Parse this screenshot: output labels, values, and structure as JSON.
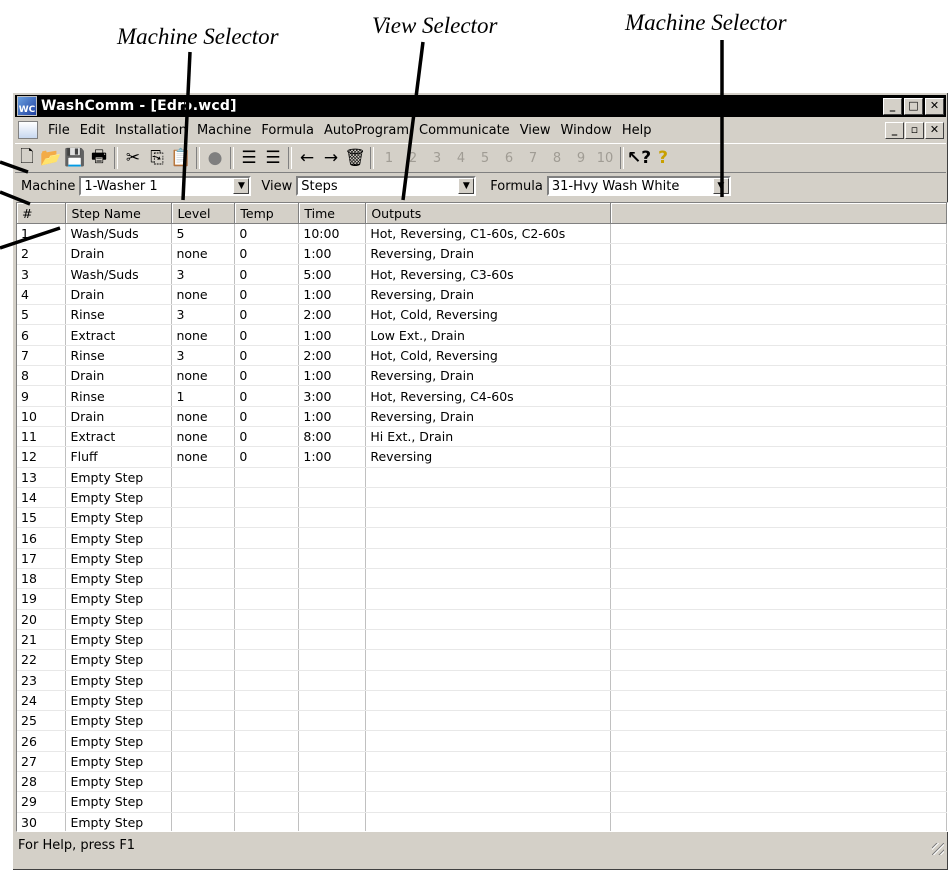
{
  "callouts": {
    "machine_selector_left": "Machine Selector",
    "view_selector": "View Selector",
    "machine_selector_right": "Machine Selector"
  },
  "window": {
    "title": "WashComm - [Edrɔ.wcd]",
    "icon_text": "WC"
  },
  "menu": {
    "file": "File",
    "edit": "Edit",
    "installation": "Installation",
    "machine": "Machine",
    "formula": "Formula",
    "autoprogram": "AutoProgram",
    "communicate": "Communicate",
    "view": "View",
    "window": "Window",
    "help": "Help"
  },
  "toolbar": {
    "icons": [
      "new-icon",
      "open-icon",
      "save-icon",
      "print-icon",
      "cut-icon",
      "copy-icon",
      "paste-icon",
      "stop-icon",
      "indent-icon",
      "outdent-icon",
      "back-icon",
      "forward-icon",
      "delete-icon"
    ],
    "step_labels": [
      "1",
      "2",
      "3",
      "4",
      "5",
      "6",
      "7",
      "8",
      "9",
      "10"
    ]
  },
  "selectors": {
    "machine_label": "Machine",
    "machine_value": "1-Washer 1",
    "view_label": "View",
    "view_value": "Steps",
    "formula_label": "Formula",
    "formula_value": "31-Hvy Wash White"
  },
  "table": {
    "headers": [
      "#",
      "Step Name",
      "Level",
      "Temp",
      "Time",
      "Outputs"
    ],
    "rows": [
      [
        "1",
        "Wash/Suds",
        "5",
        "0",
        "10:00",
        "Hot, Reversing, C1-60s, C2-60s"
      ],
      [
        "2",
        "Drain",
        "none",
        "0",
        "1:00",
        "Reversing, Drain"
      ],
      [
        "3",
        "Wash/Suds",
        "3",
        "0",
        "5:00",
        "Hot, Reversing, C3-60s"
      ],
      [
        "4",
        "Drain",
        "none",
        "0",
        "1:00",
        "Reversing, Drain"
      ],
      [
        "5",
        "Rinse",
        "3",
        "0",
        "2:00",
        "Hot, Cold, Reversing"
      ],
      [
        "6",
        "Extract",
        "none",
        "0",
        "1:00",
        "Low Ext., Drain"
      ],
      [
        "7",
        "Rinse",
        "3",
        "0",
        "2:00",
        "Hot, Cold, Reversing"
      ],
      [
        "8",
        "Drain",
        "none",
        "0",
        "1:00",
        "Reversing, Drain"
      ],
      [
        "9",
        "Rinse",
        "1",
        "0",
        "3:00",
        "Hot, Reversing, C4-60s"
      ],
      [
        "10",
        "Drain",
        "none",
        "0",
        "1:00",
        "Reversing, Drain"
      ],
      [
        "11",
        "Extract",
        "none",
        "0",
        "8:00",
        "Hi Ext., Drain"
      ],
      [
        "12",
        "Fluff",
        "none",
        "0",
        "1:00",
        "Reversing"
      ],
      [
        "13",
        "Empty Step",
        "",
        "",
        "",
        ""
      ],
      [
        "14",
        "Empty Step",
        "",
        "",
        "",
        ""
      ],
      [
        "15",
        "Empty Step",
        "",
        "",
        "",
        ""
      ],
      [
        "16",
        "Empty Step",
        "",
        "",
        "",
        ""
      ],
      [
        "17",
        "Empty Step",
        "",
        "",
        "",
        ""
      ],
      [
        "18",
        "Empty Step",
        "",
        "",
        "",
        ""
      ],
      [
        "19",
        "Empty Step",
        "",
        "",
        "",
        ""
      ],
      [
        "20",
        "Empty Step",
        "",
        "",
        "",
        ""
      ],
      [
        "21",
        "Empty Step",
        "",
        "",
        "",
        ""
      ],
      [
        "22",
        "Empty Step",
        "",
        "",
        "",
        ""
      ],
      [
        "23",
        "Empty Step",
        "",
        "",
        "",
        ""
      ],
      [
        "24",
        "Empty Step",
        "",
        "",
        "",
        ""
      ],
      [
        "25",
        "Empty Step",
        "",
        "",
        "",
        ""
      ],
      [
        "26",
        "Empty Step",
        "",
        "",
        "",
        ""
      ],
      [
        "27",
        "Empty Step",
        "",
        "",
        "",
        ""
      ],
      [
        "28",
        "Empty Step",
        "",
        "",
        "",
        ""
      ],
      [
        "29",
        "Empty Step",
        "",
        "",
        "",
        ""
      ],
      [
        "30",
        "Empty Step",
        "",
        "",
        "",
        ""
      ]
    ]
  },
  "status": {
    "text": "For Help, press F1"
  }
}
